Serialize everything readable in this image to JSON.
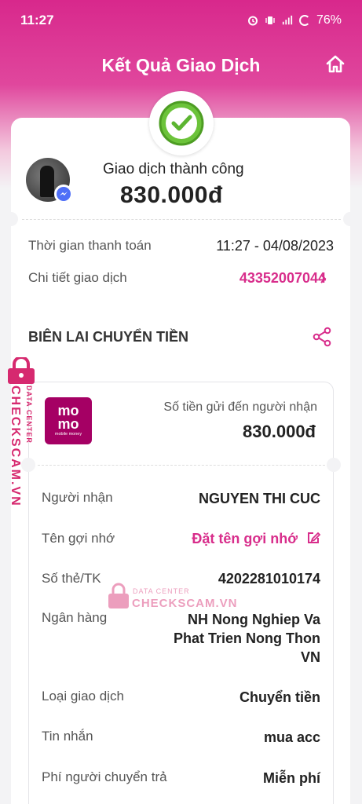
{
  "status_bar": {
    "time": "11:27",
    "battery": "76%"
  },
  "header": {
    "title": "Kết Quả Giao Dịch"
  },
  "summary": {
    "status": "Giao dịch thành công",
    "amount": "830.000đ"
  },
  "details": {
    "time_label": "Thời gian thanh toán",
    "time_value": "11:27 - 04/08/2023",
    "txn_label": "Chi tiết giao dịch",
    "txn_value": "43352007044"
  },
  "receipt": {
    "heading": "BIÊN LAI CHUYỂN TIỀN",
    "logo_top": "mo",
    "logo_bottom": "mo",
    "logo_sub": "mobile money",
    "amount_label": "Số tiền gửi đến người nhận",
    "amount_value": "830.000đ",
    "rows": [
      {
        "label": "Người nhận",
        "value": "NGUYEN THI CUC"
      },
      {
        "label": "Tên gợi nhớ",
        "value": "Đặt tên gợi nhớ"
      },
      {
        "label": "Số thẻ/TK",
        "value": "4202281010174"
      },
      {
        "label": "Ngân hàng",
        "value_lines": [
          "NH Nong Nghiep Va",
          "Phat Trien Nong Thon",
          "VN"
        ]
      },
      {
        "label": "Loại giao dịch",
        "value": "Chuyển tiền"
      },
      {
        "label": "Tin nhắn",
        "value": "mua acc"
      },
      {
        "label": "Phí người chuyển trả",
        "value": "Miễn phí"
      }
    ]
  },
  "watermark": {
    "small": "DATA CENTER",
    "big": "CHECKSCAM.VN"
  },
  "colors": {
    "brand": "#d82d8b",
    "momo": "#a50064",
    "success": "#5cb531"
  },
  "icons": [
    "home-icon",
    "check-icon",
    "messenger-icon",
    "chevron-right-icon",
    "share-icon",
    "edit-icon",
    "lock-icon"
  ]
}
